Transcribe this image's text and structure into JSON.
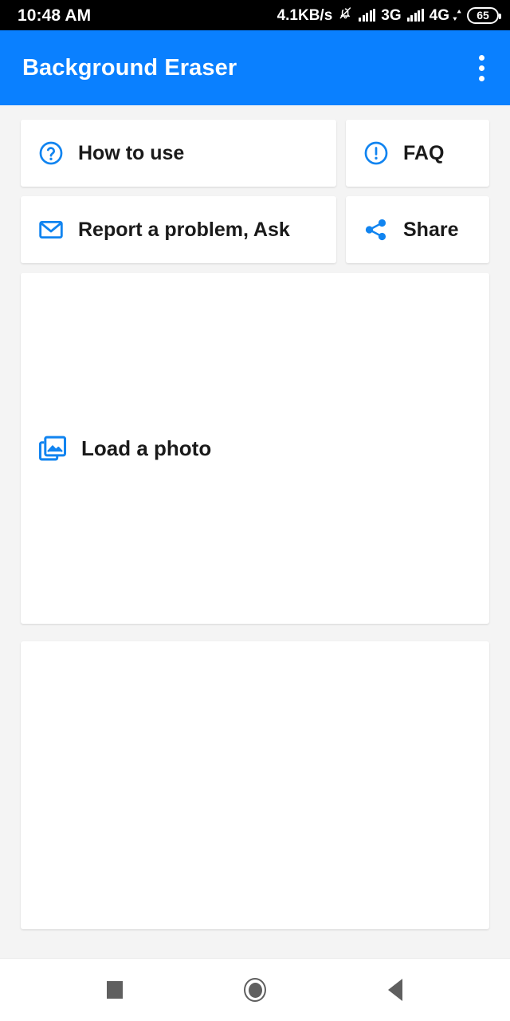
{
  "status_bar": {
    "clock": "10:48 AM",
    "net_speed": "4.1KB/s",
    "mute_icon": "bell-slash-icon",
    "signal_1_label": "3G",
    "signal_2_label": "4G",
    "data_activity_icon": "data-transfer-icon",
    "battery_level": "65",
    "background_color": "#000000",
    "text_color": "#FFFFFF"
  },
  "app_bar": {
    "title": "Background Eraser",
    "overflow_icon": "more-vertical-icon",
    "background_color": "#0A80FF",
    "title_color": "#FFFFFF"
  },
  "menu": {
    "accent_color": "#1184F0",
    "row1": [
      {
        "label": "How to use",
        "icon": "help-circle-icon"
      },
      {
        "label": "FAQ",
        "icon": "alert-circle-icon"
      }
    ],
    "row2": [
      {
        "label": "Report a problem, Ask",
        "icon": "mail-icon"
      },
      {
        "label": "Share",
        "icon": "share-nodes-icon"
      }
    ]
  },
  "photo_area": {
    "label": "Load a photo",
    "icon": "photo-library-icon"
  },
  "nav_bar": {
    "recents_icon": "square-icon",
    "home_icon": "circle-home-icon",
    "back_icon": "triangle-back-icon",
    "icon_color": "#5F5F5F"
  }
}
